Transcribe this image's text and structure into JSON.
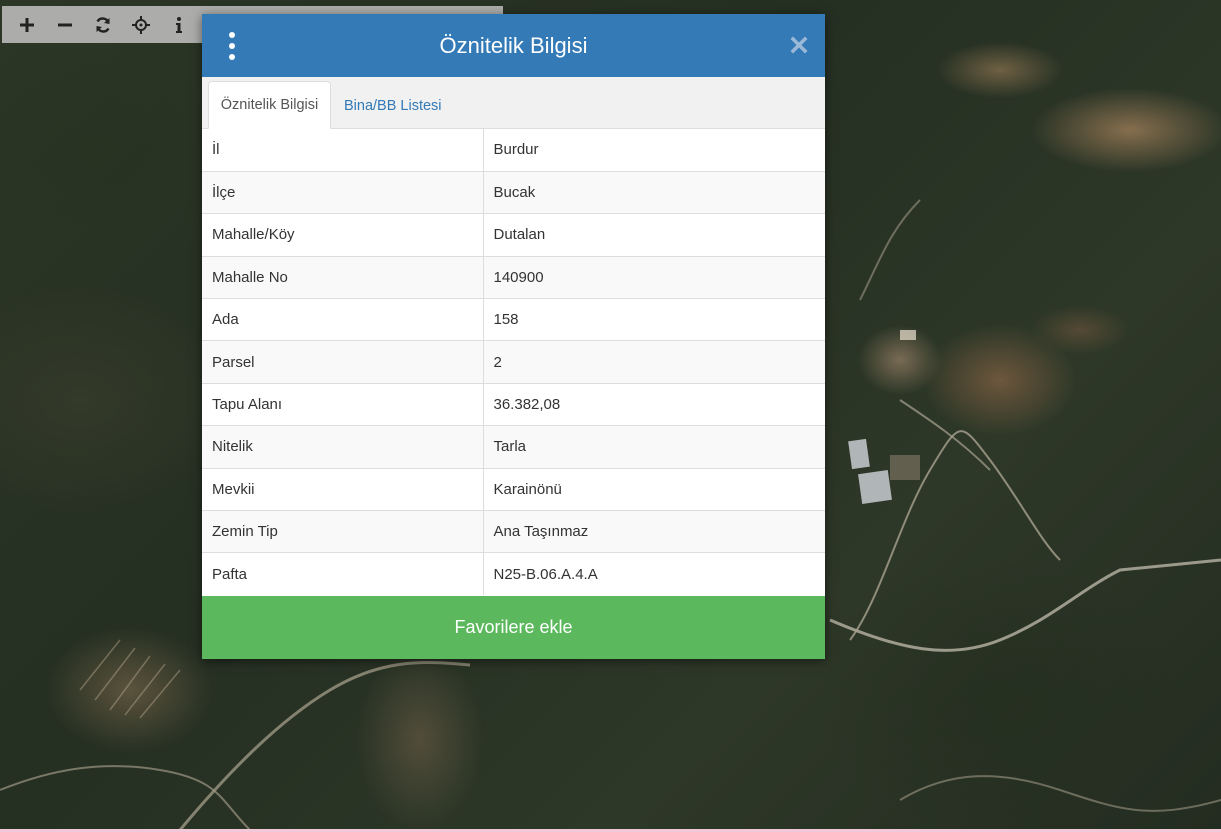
{
  "modal": {
    "title": "Öznitelik Bilgisi",
    "tabs": [
      {
        "label": "Öznitelik Bilgisi",
        "active": true
      },
      {
        "label": "Bina/BB Listesi",
        "active": false
      }
    ],
    "rows": [
      {
        "key": "İl",
        "value": "Burdur"
      },
      {
        "key": "İlçe",
        "value": "Bucak"
      },
      {
        "key": "Mahalle/Köy",
        "value": "Dutalan"
      },
      {
        "key": "Mahalle No",
        "value": "140900"
      },
      {
        "key": "Ada",
        "value": "158"
      },
      {
        "key": "Parsel",
        "value": "2"
      },
      {
        "key": "Tapu Alanı",
        "value": "36.382,08"
      },
      {
        "key": "Nitelik",
        "value": "Tarla"
      },
      {
        "key": "Mevkii",
        "value": "Karainönü"
      },
      {
        "key": "Zemin Tip",
        "value": "Ana Taşınmaz"
      },
      {
        "key": "Pafta",
        "value": "N25-B.06.A.4.A"
      }
    ],
    "favorite_button_label": "Favorilere ekle"
  },
  "toolbar": {
    "tools": [
      "plus-icon",
      "minus-icon",
      "refresh-icon",
      "crosshair-icon",
      "info-icon"
    ]
  },
  "colors": {
    "header": "#337ab7",
    "favorite_button": "#5cb85c",
    "tab_link": "#337ab7"
  }
}
